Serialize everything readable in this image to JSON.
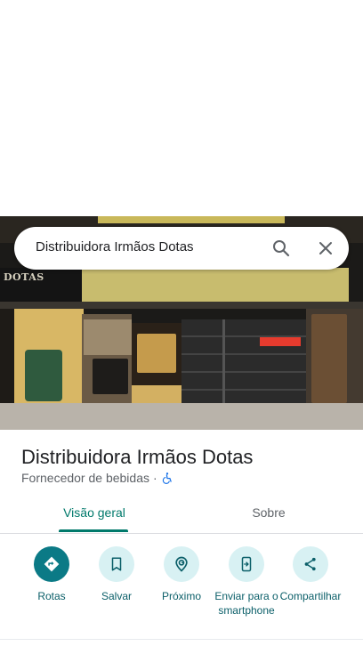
{
  "search": {
    "query": "Distribuidora Irmãos Dotas"
  },
  "photo": {
    "sign_text": "DOTAS"
  },
  "place": {
    "title": "Distribuidora Irmãos Dotas",
    "category": "Fornecedor de bebidas",
    "separator": "·",
    "accessibility_icon": "wheelchair-icon"
  },
  "tabs": [
    {
      "label": "Visão geral",
      "active": true
    },
    {
      "label": "Sobre",
      "active": false
    }
  ],
  "actions": [
    {
      "label": "Rotas",
      "icon": "directions-icon"
    },
    {
      "label": "Salvar",
      "icon": "bookmark-icon"
    },
    {
      "label": "Próximo",
      "icon": "nearby-icon"
    },
    {
      "label": "Enviar para o smartphone",
      "icon": "send-to-phone-icon"
    },
    {
      "label": "Compartilhar",
      "icon": "share-icon"
    }
  ],
  "colors": {
    "accent": "#00796b",
    "primary_action": "#0b7a86",
    "action_bg": "#d8f1f3",
    "accessibility": "#1a73e8"
  }
}
